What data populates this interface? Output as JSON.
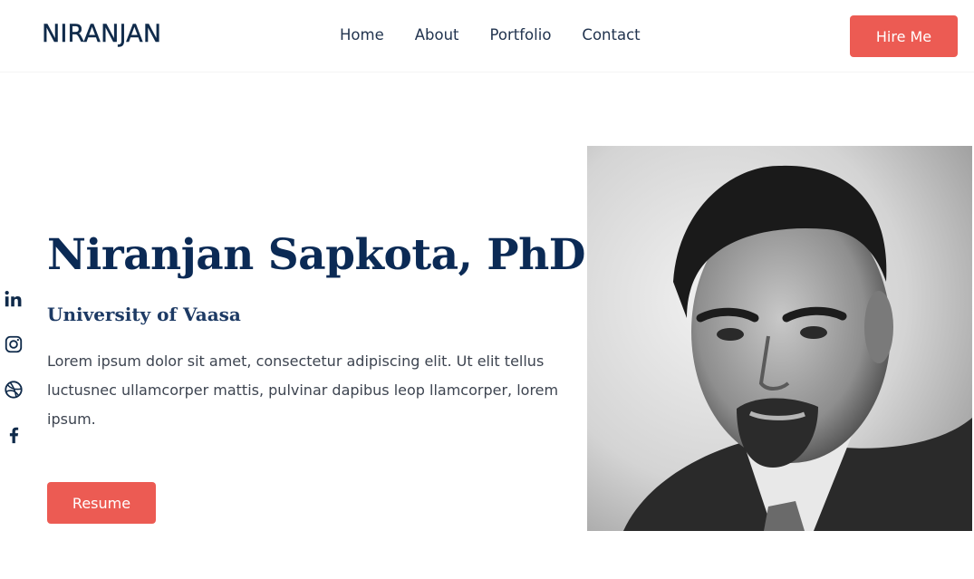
{
  "nav": {
    "logo": "NIRANJAN",
    "links": [
      "Home",
      "About",
      "Portfolio",
      "Contact"
    ],
    "cta_label": "Hire Me"
  },
  "hero": {
    "name": "Niranjan Sapkota, PhD",
    "subtitle": "University of Vaasa",
    "description": "Lorem ipsum dolor sit amet, consectetur adipiscing elit. Ut elit tellus luctusnec ullamcorper mattis, pulvinar dapibus leop llamcorper, lorem ipsum.",
    "resume_label": "Resume"
  },
  "social_icons": [
    "linkedin-icon",
    "instagram-icon",
    "dribbble-icon",
    "facebook-icon"
  ],
  "colors": {
    "accent": "#ec5b53",
    "heading": "#0b2a55",
    "text": "#3d4450"
  }
}
